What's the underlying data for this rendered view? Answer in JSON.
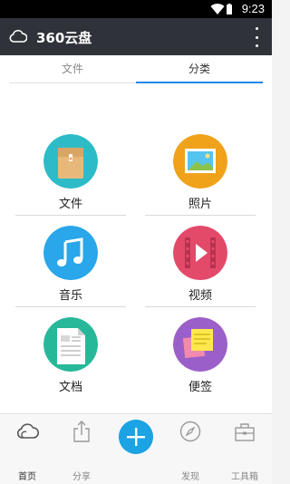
{
  "status": {
    "time": "9:23"
  },
  "appbar": {
    "title": "360云盘"
  },
  "tabs": [
    {
      "label": "文件"
    },
    {
      "label": "分类"
    }
  ],
  "categories": [
    {
      "label": "文件",
      "icon": "folder-icon"
    },
    {
      "label": "照片",
      "icon": "photo-icon"
    },
    {
      "label": "音乐",
      "icon": "music-icon"
    },
    {
      "label": "视频",
      "icon": "video-icon"
    },
    {
      "label": "文档",
      "icon": "document-icon"
    },
    {
      "label": "便签",
      "icon": "note-icon"
    }
  ],
  "bottomnav": [
    {
      "label": "首页",
      "icon": "cloud-icon"
    },
    {
      "label": "分享",
      "icon": "share-icon"
    },
    {
      "label": "发现",
      "icon": "compass-icon"
    },
    {
      "label": "工具箱",
      "icon": "toolbox-icon"
    }
  ],
  "colors": {
    "appbar": "#2f3339",
    "accent": "#1e88e5",
    "fab": "#1ca3e3",
    "folder": "#2dbcc7",
    "photo": "#f0a21b",
    "music": "#2aa6ea",
    "video": "#e34a6a",
    "document": "#27b89a",
    "note": "#9b5fc9"
  }
}
